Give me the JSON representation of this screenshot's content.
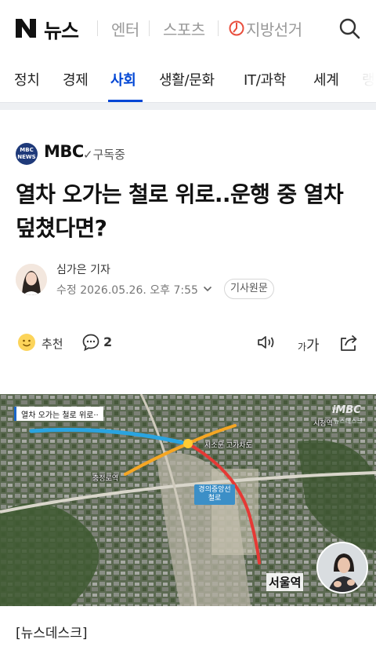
{
  "header": {
    "logo": "N",
    "brand": "뉴스",
    "links": [
      "엔터",
      "스포츠",
      "지방선거"
    ]
  },
  "categories": [
    {
      "label": "정치",
      "active": false
    },
    {
      "label": "경제",
      "active": false
    },
    {
      "label": "사회",
      "active": true
    },
    {
      "label": "생활/문화",
      "active": false
    },
    {
      "label": "IT/과학",
      "active": false
    },
    {
      "label": "세계",
      "active": false
    },
    {
      "label": "랭",
      "active": false
    }
  ],
  "press": {
    "logo_text": "MBC NEWS",
    "name": "MBC",
    "subscribe": "구독중"
  },
  "article": {
    "headline": "열차 오가는 철로 위로..운행 중 열차 덮쳤다면?",
    "reporter": "심가은 기자",
    "dateline": "수정 2026.05.26. 오후 7:55",
    "original_button": "기사원문"
  },
  "actions": {
    "recommend_label": "추천",
    "comment_count": "2",
    "font_glyph_small": "가",
    "font_glyph_large": "가"
  },
  "photo": {
    "overlay_title": "열차 오가는 철로 위로··",
    "watermark": "iMBC",
    "watermark_sub": "뉴스데스크",
    "labels": {
      "city_hall": "시청역",
      "overpass": "서소문 고가차도",
      "chungjeongno": "충정로역",
      "line": "경의중앙선 철로",
      "seoul_station": "서울역"
    }
  },
  "body": {
    "section": "[뉴스데스크]"
  },
  "colors": {
    "accent": "#0046d5",
    "route_red": "#e53935",
    "route_yellow": "#f5a623",
    "route_blue": "#2aa4e0"
  }
}
